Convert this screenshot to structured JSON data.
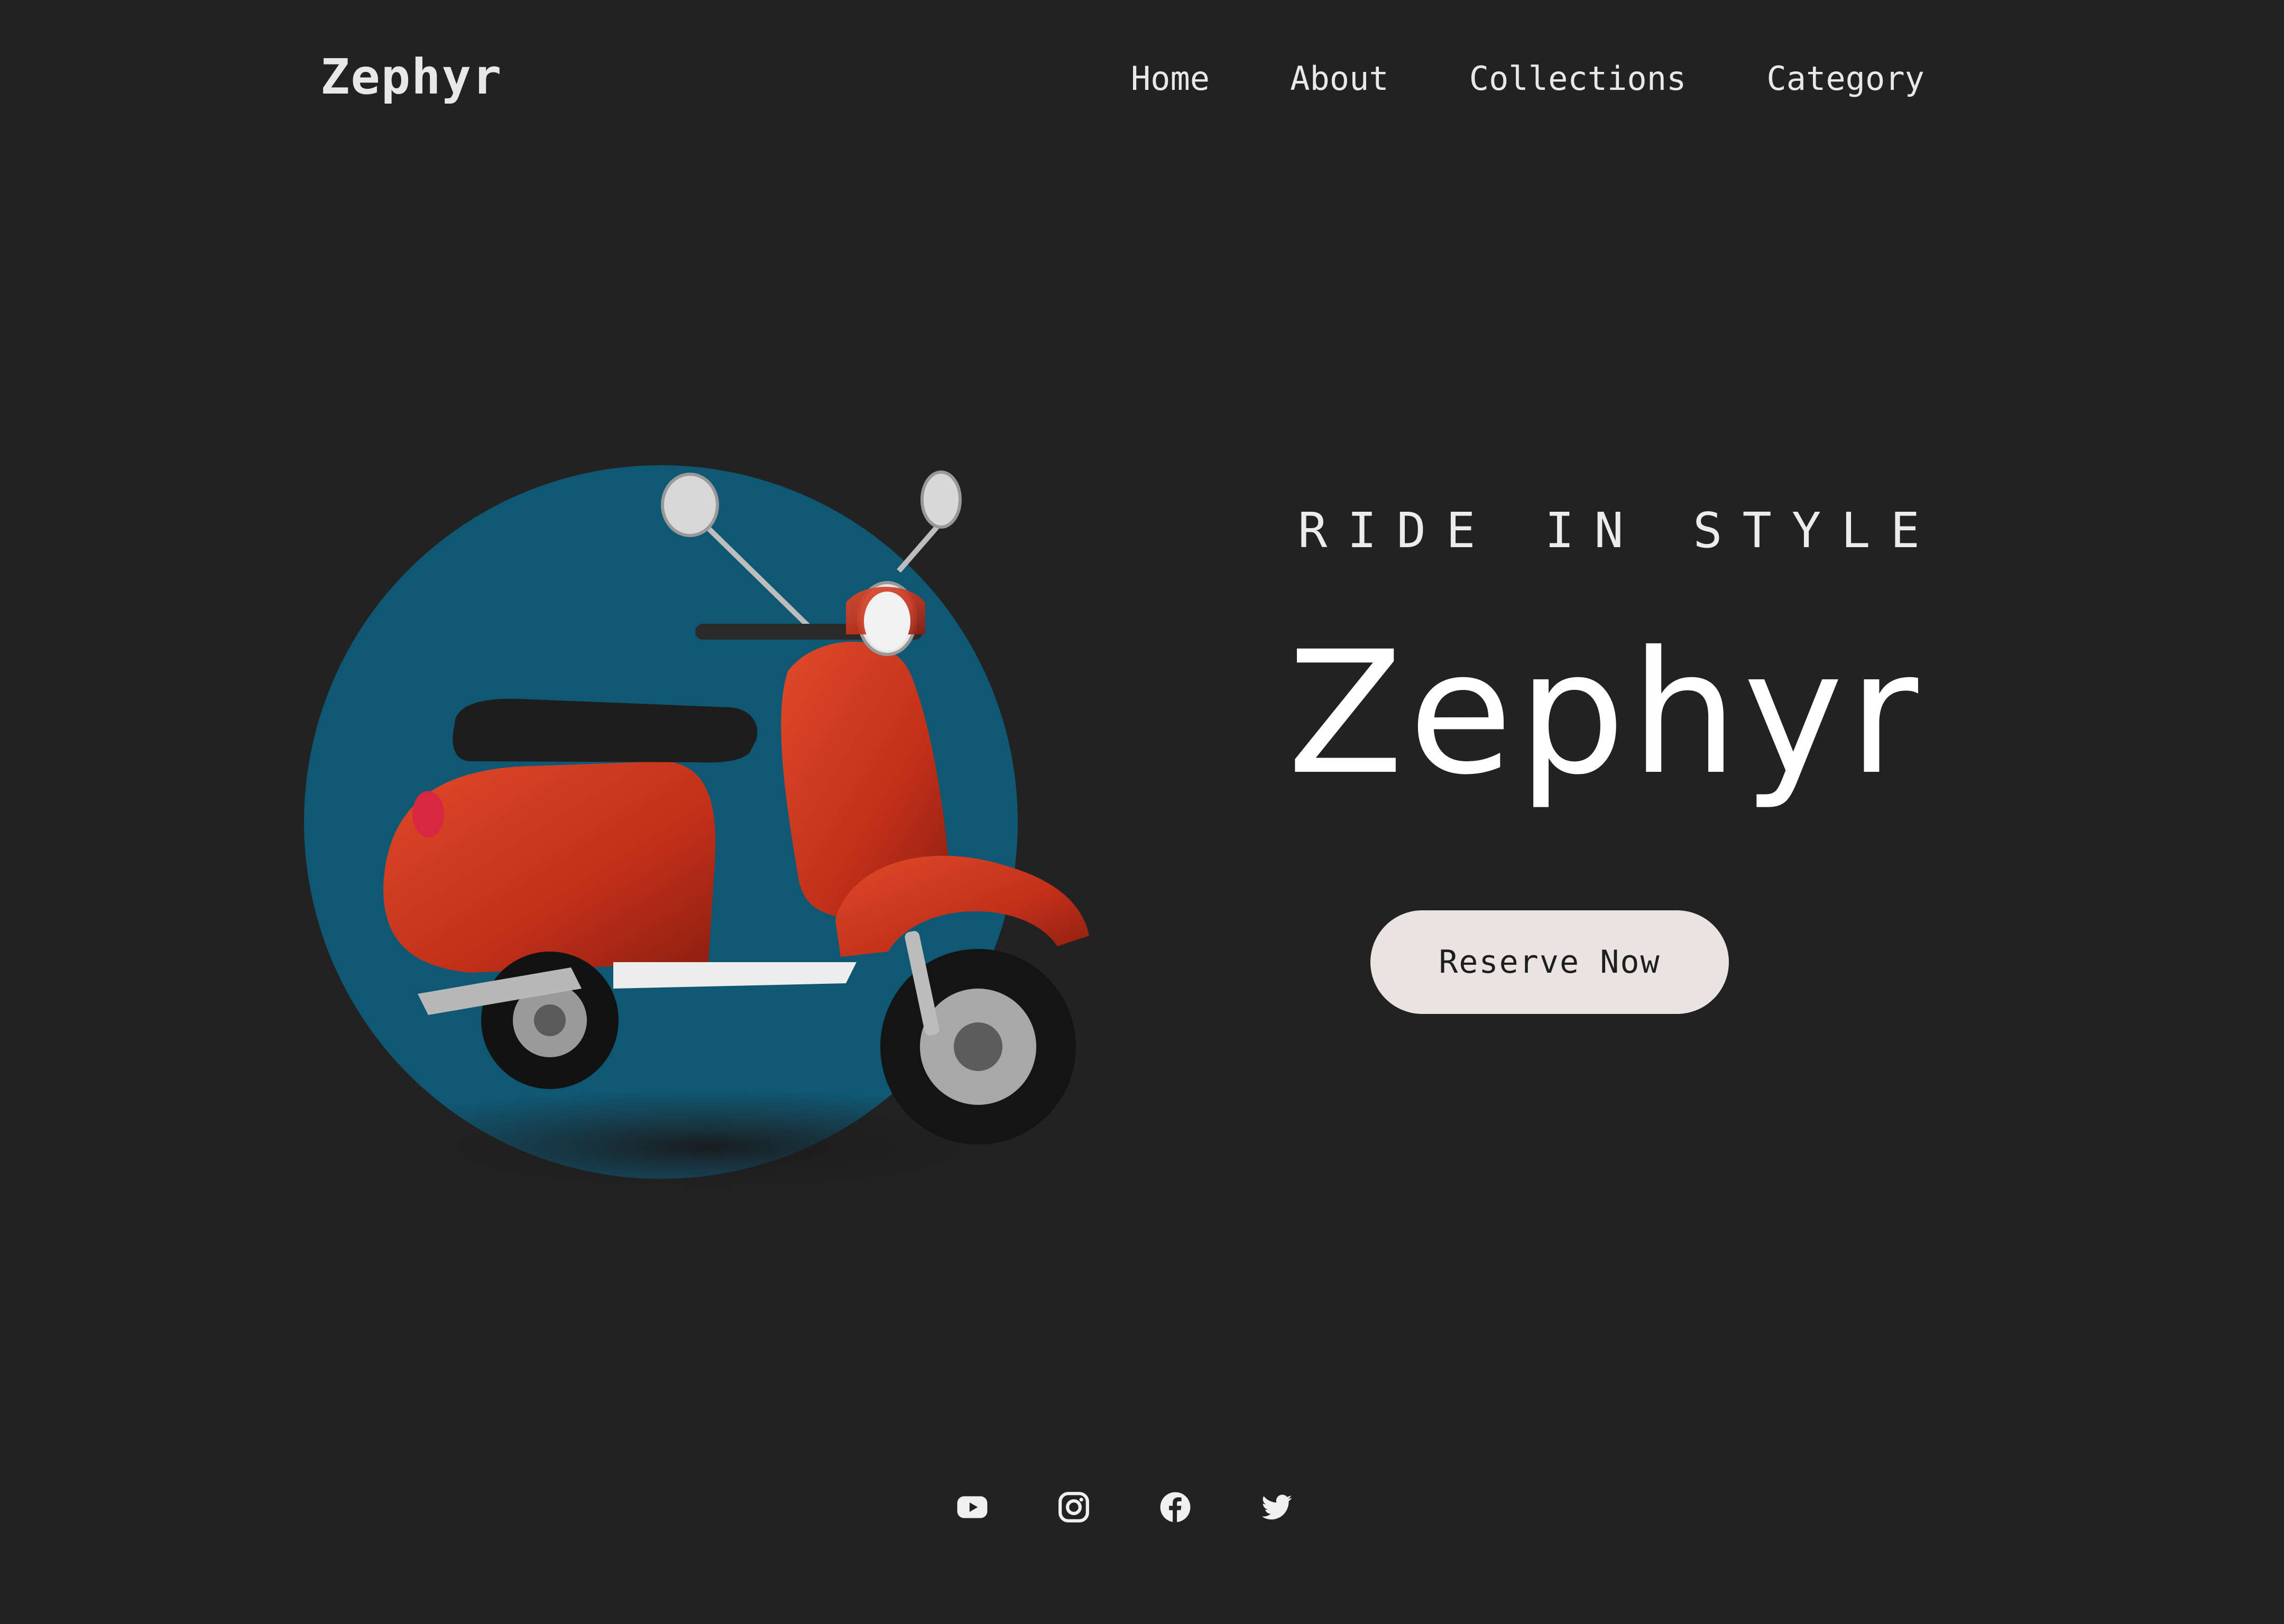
{
  "header": {
    "logo": "Zephyr",
    "nav": [
      "Home",
      "About",
      "Collections",
      "Category"
    ]
  },
  "hero": {
    "tagline": "RIDE IN STYLE",
    "title": "Zephyr",
    "cta_label": "Reserve Now",
    "image": "red-scooter",
    "circle_color": "#0f5874",
    "scooter_color": "#c9331c"
  },
  "social": {
    "icons": [
      "youtube-icon",
      "instagram-icon",
      "facebook-icon",
      "twitter-icon"
    ]
  },
  "colors": {
    "background": "#222222",
    "button_bg": "#e9e4e2",
    "text": "#ffffff"
  }
}
